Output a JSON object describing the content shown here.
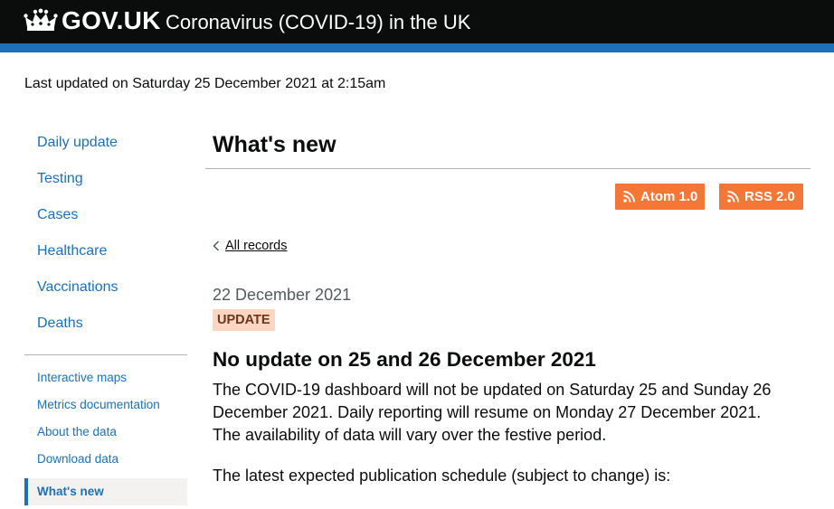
{
  "header": {
    "logo_text": "GOV.UK",
    "service_name": "Coronavirus (COVID-19) in the UK"
  },
  "last_updated": "Last updated on Saturday 25 December 2021 at 2:15am",
  "nav": {
    "primary": [
      "Daily update",
      "Testing",
      "Cases",
      "Healthcare",
      "Vaccinations",
      "Deaths"
    ],
    "secondary": [
      "Interactive maps",
      "Metrics documentation",
      "About the data",
      "Download data"
    ],
    "active": "What's new"
  },
  "page": {
    "title": "What's new",
    "feeds": {
      "atom": "Atom 1.0",
      "rss": "RSS 2.0"
    },
    "back_link": "All records"
  },
  "entry": {
    "date": "22 December 2021",
    "tag": "UPDATE",
    "heading": "No update on 25 and 26 December 2021",
    "body": "The COVID-19 dashboard will not be updated on Saturday 25 and Sunday 26 December 2021. Daily reporting will resume on Monday 27 December 2021. The availability of data will vary over the festive period.",
    "schedule_intro": "The latest expected publication schedule (subject to change) is:"
  },
  "colors": {
    "header_bg": "#0b0c0c",
    "header_stripe": "#1d70b8",
    "link": "#1d70b8",
    "feed_button": "#f47738",
    "tag_bg": "#fcd6c3",
    "tag_text": "#6e3619"
  },
  "icons": [
    "crown-icon",
    "rss-icon",
    "chevron-left-icon"
  ]
}
